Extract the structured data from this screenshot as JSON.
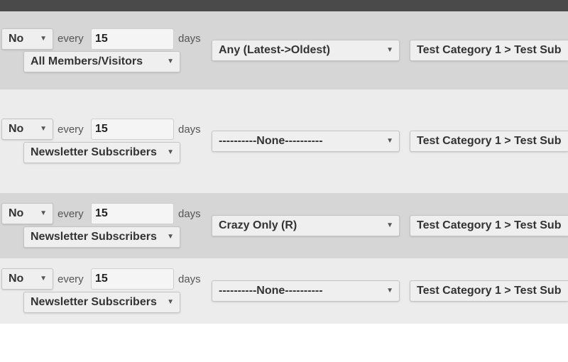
{
  "rows": [
    {
      "enabled": "No",
      "every_label": "every",
      "interval": "15",
      "days_label": "days",
      "audience": "All Members/Visitors",
      "order": "Any (Latest->Oldest)",
      "category": "Test Category 1 > Test Sub"
    },
    {
      "enabled": "No",
      "every_label": "every",
      "interval": "15",
      "days_label": "days",
      "audience": "Newsletter Subscribers",
      "order": "----------None----------",
      "category": "Test Category 1 > Test Sub"
    },
    {
      "enabled": "No",
      "every_label": "every",
      "interval": "15",
      "days_label": "days",
      "audience": "Newsletter Subscribers",
      "order": "Crazy Only (R)",
      "category": "Test Category 1 > Test Sub"
    },
    {
      "enabled": "No",
      "every_label": "every",
      "interval": "15",
      "days_label": "days",
      "audience": "Newsletter Subscribers",
      "order": "----------None----------",
      "category": "Test Category 1 > Test Sub"
    }
  ],
  "icons": {
    "dropdown": "chevron-down-icon"
  },
  "colors": {
    "header_bar": "#4a4a4a",
    "row_dark": "#d6d6d6",
    "row_light": "#ececec"
  }
}
